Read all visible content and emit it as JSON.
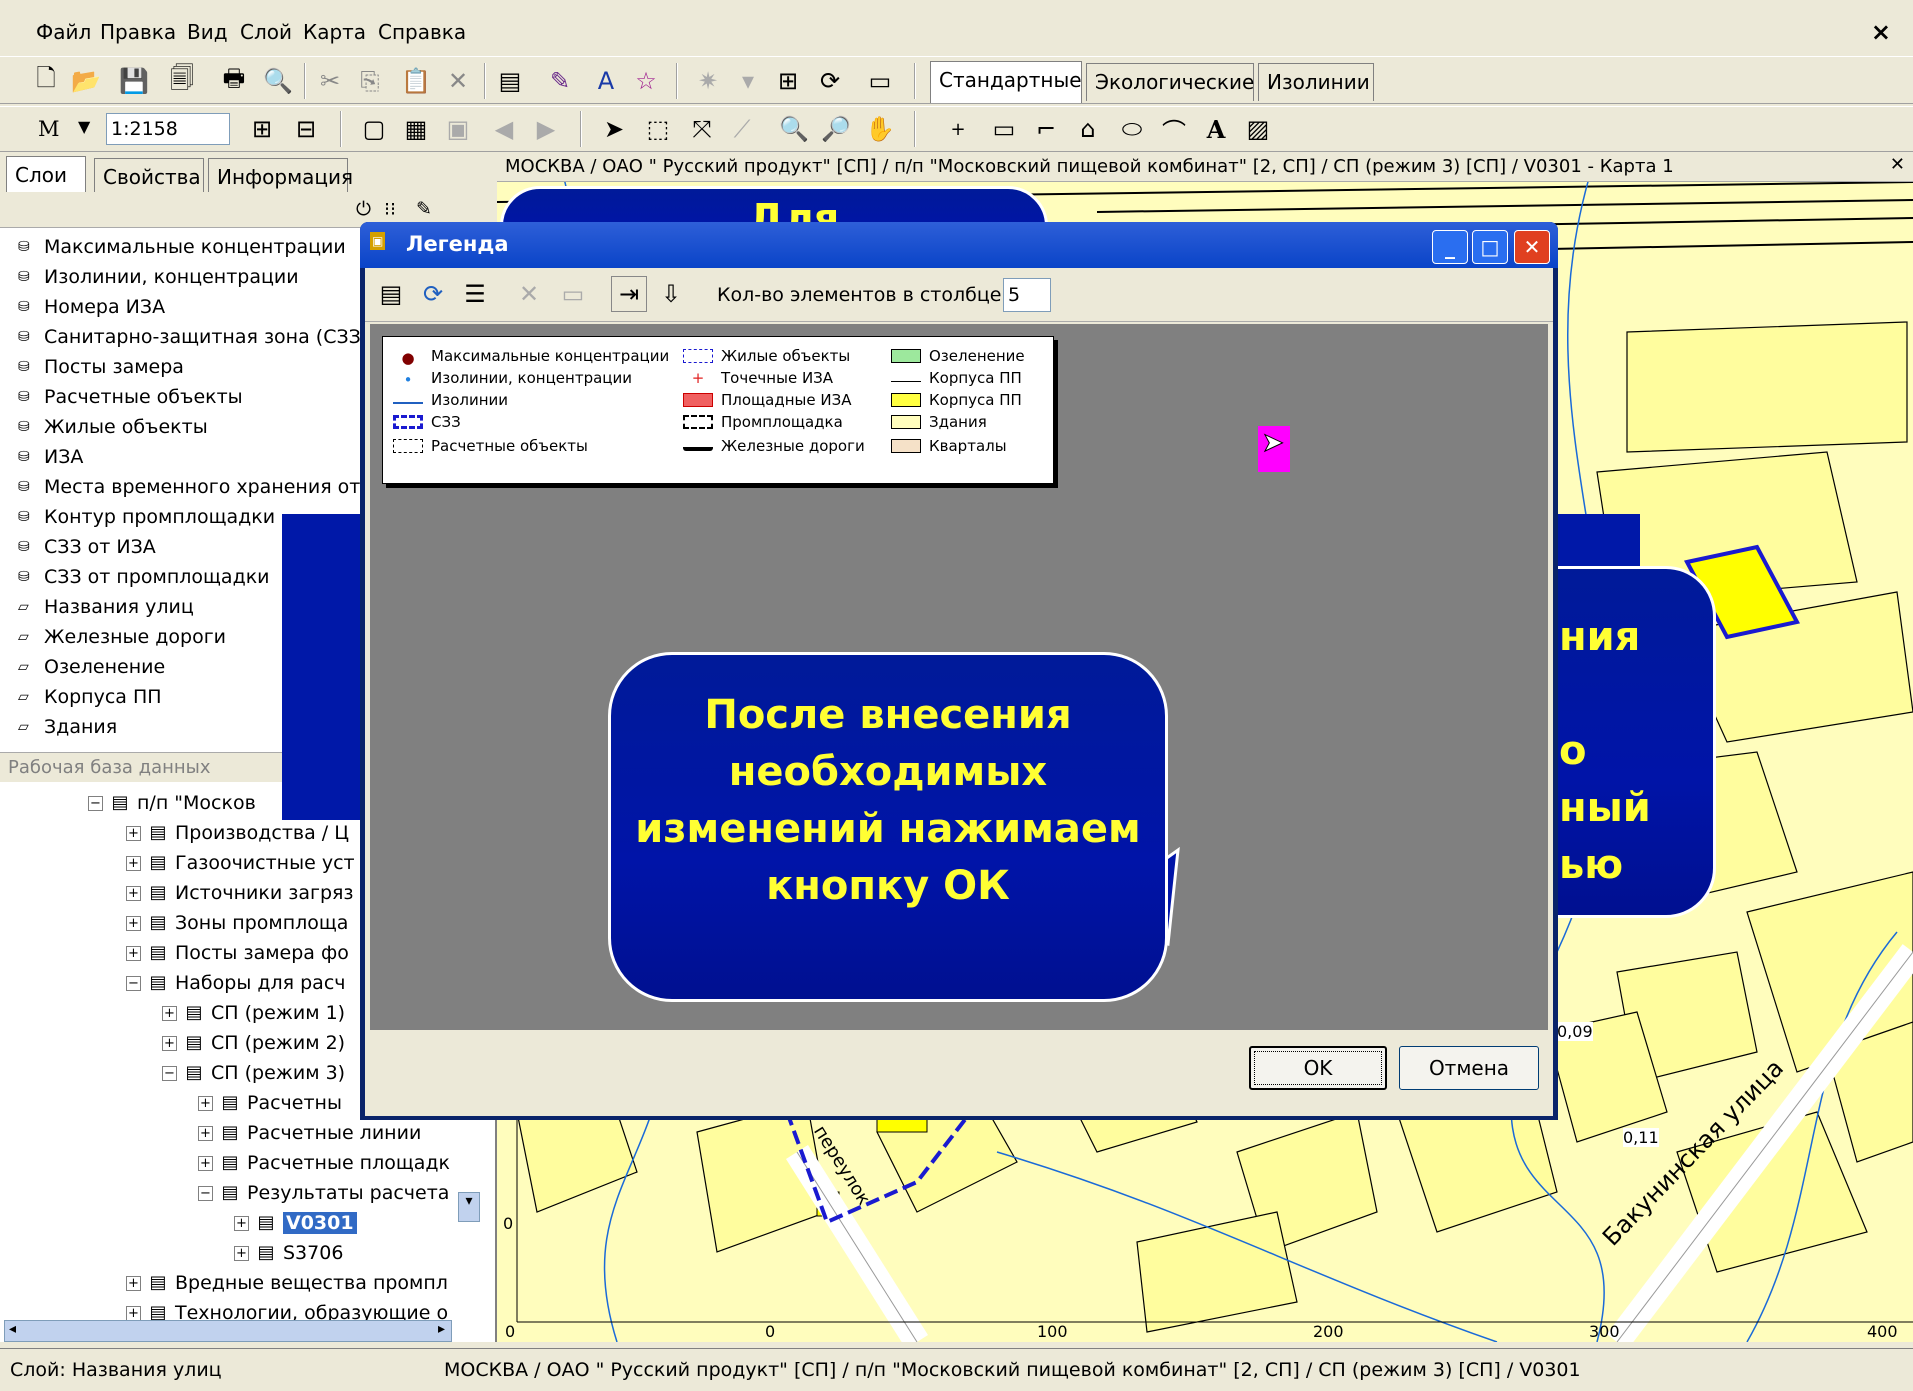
{
  "menu": {
    "items": [
      "Файл",
      "Правка",
      "Вид",
      "Слой",
      "Карта",
      "Справка"
    ],
    "close": "×"
  },
  "toolbar2": {
    "scale_prefix": "М",
    "scale_value": "1:2158"
  },
  "right_tabs": [
    "Стандартные",
    "Экологические",
    "Изолинии"
  ],
  "left_tabs": [
    "Слои",
    "Свойства",
    "Информация"
  ],
  "map": {
    "header": "МОСКВА / ОАО \" Русский продукт\" [СП] / п/п \"Московский пищевой комбинат\" [2, СП] / СП (режим 3) [СП] / V0301 - Карта 1",
    "axis_x": [
      "0",
      "0",
      "100",
      "200",
      "300",
      "400"
    ],
    "axis_y": "0",
    "labels": {
      "iso1": "0,09",
      "iso2": "0,11",
      "street1": "Бакунинская улица",
      "street2": "переулок"
    }
  },
  "layers": [
    "Максимальные концентрации",
    "Изолинии, концентрации",
    "Номера ИЗА",
    "Санитарно-защитная зона (СЗЗ)",
    "Посты замера",
    "Расчетные объекты",
    "Жилые объекты",
    "ИЗА",
    "Места временного хранения от",
    "Контур промплощадки",
    "СЗЗ от ИЗА",
    "СЗЗ от промплощадки",
    "Названия улиц",
    "Железные дороги",
    "Озеленение",
    "Корпуса ПП",
    "Здания"
  ],
  "db": {
    "header": "Рабочая база данных",
    "tree": [
      "п/п \"Москов",
      "Производства / Ц",
      "Газоочистные уст",
      "Источники загряз",
      "Зоны промплоща",
      "Посты замера фо",
      "Наборы для расч",
      "СП (режим 1)",
      "СП (режим 2)",
      "СП (режим 3)",
      "Расчетны",
      "Расчетные линии",
      "Расчетные площадк",
      "Результаты расчета",
      "V0301",
      "S3706",
      "Вредные вещества промпл",
      "Технологии, образующие о"
    ]
  },
  "status": {
    "left": "Слой: Названия улиц",
    "right": "МОСКВА / ОАО \" Русский продукт\" [СП] / п/п \"Московский пищевой комбинат\" [2, СП] / СП (режим 3) [СП] / V0301"
  },
  "dialog": {
    "title": "Легенда",
    "cols_label": "Кол-во элементов в столбце:",
    "cols_value": "5",
    "ok": "OK",
    "cancel": "Отмена",
    "legend": {
      "col1": [
        "Максимальные концентрации",
        "Изолинии, концентрации",
        "Изолинии",
        "СЗЗ",
        "Расчетные объекты"
      ],
      "col2": [
        "Жилые объекты",
        "Точечные ИЗА",
        "Площадные ИЗА",
        "Промплощадка",
        "Железные дороги"
      ],
      "col3": [
        "Озеленение",
        "Корпуса ПП",
        "Корпуса ПП",
        "Здания",
        "Кварталы"
      ]
    }
  },
  "callouts": {
    "main": "После внесения необходимых изменений нажимаем кнопку ОК",
    "top": "Для",
    "right_lines": [
      "ния",
      "о",
      "ный",
      "ью"
    ]
  },
  "colors": {
    "map_bg": "#fffdbd",
    "callout_text": "#ffff33",
    "callout_bg": "#0014a8",
    "title_bar": "#0a44c8"
  }
}
